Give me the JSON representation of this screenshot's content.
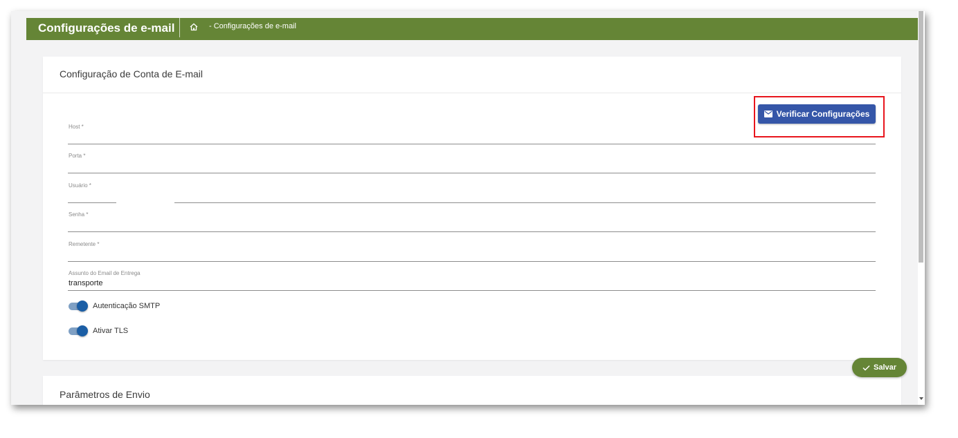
{
  "header": {
    "title": "Configurações de e-mail",
    "breadcrumb": "- Configurações de e-mail",
    "home_icon": "home-icon"
  },
  "account_card": {
    "title": "Configuração de Conta de E-mail",
    "verify_button": {
      "label": "Verificar Configurações",
      "icon": "mail-icon"
    },
    "fields": {
      "host": {
        "label": "Host *",
        "value": ""
      },
      "port": {
        "label": "Porta *",
        "value": ""
      },
      "user": {
        "label": "Usuário *",
        "value": ""
      },
      "password": {
        "label": "Senha *",
        "value": ""
      },
      "sender": {
        "label": "Remetente *",
        "value": ""
      },
      "subject": {
        "label": "Assunto do Email de Entrega",
        "value": "transporte"
      }
    },
    "toggles": {
      "smtp_auth": {
        "label": "Autenticação SMTP",
        "checked": true
      },
      "tls": {
        "label": "Ativar TLS",
        "checked": true
      }
    }
  },
  "params_card": {
    "title": "Parâmetros de Envio"
  },
  "save_button": {
    "label": "Salvar",
    "icon": "check-icon"
  },
  "colors": {
    "brand_green": "#658536",
    "primary_blue": "#3556a8",
    "toggle_blue": "#1b5ea5",
    "highlight_red": "#e8141c"
  }
}
